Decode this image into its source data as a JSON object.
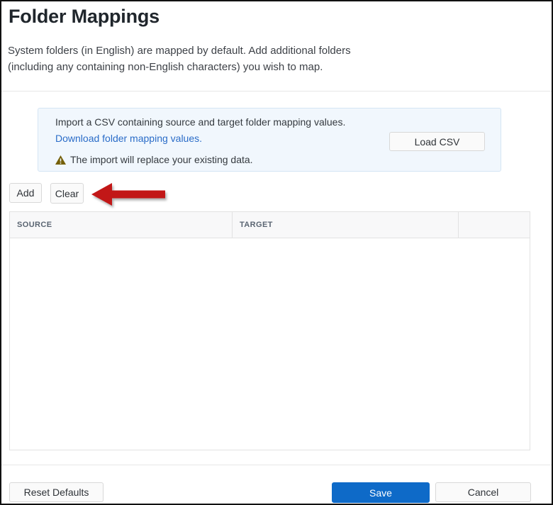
{
  "page": {
    "title": "Folder Mappings",
    "description_line1": "System folders (in English) are mapped by default. Add additional folders",
    "description_line2": "(including any containing non-English characters) you wish to map."
  },
  "import_panel": {
    "instruction": "Import a CSV containing source and target folder mapping values.",
    "download_link": "Download folder mapping values.",
    "warning_text": "The import will replace your existing data.",
    "load_csv_label": "Load CSV",
    "icons": {
      "warning": "warning-triangle-icon"
    },
    "colors": {
      "panel_background": "#f1f7fd",
      "panel_border": "#d4e5f4",
      "link_blue": "#2a6cc8",
      "warning_gold": "#756008"
    }
  },
  "toolbar": {
    "add_label": "Add",
    "clear_label": "Clear",
    "annotation": {
      "icon": "red-arrow-left-icon",
      "points_at": "Clear",
      "color": "#c21717"
    }
  },
  "table": {
    "columns": [
      "SOURCE",
      "TARGET",
      ""
    ],
    "rows": []
  },
  "footer": {
    "reset_label": "Reset Defaults",
    "save_label": "Save",
    "cancel_label": "Cancel",
    "colors": {
      "save_blue": "#0e6ac8"
    }
  }
}
